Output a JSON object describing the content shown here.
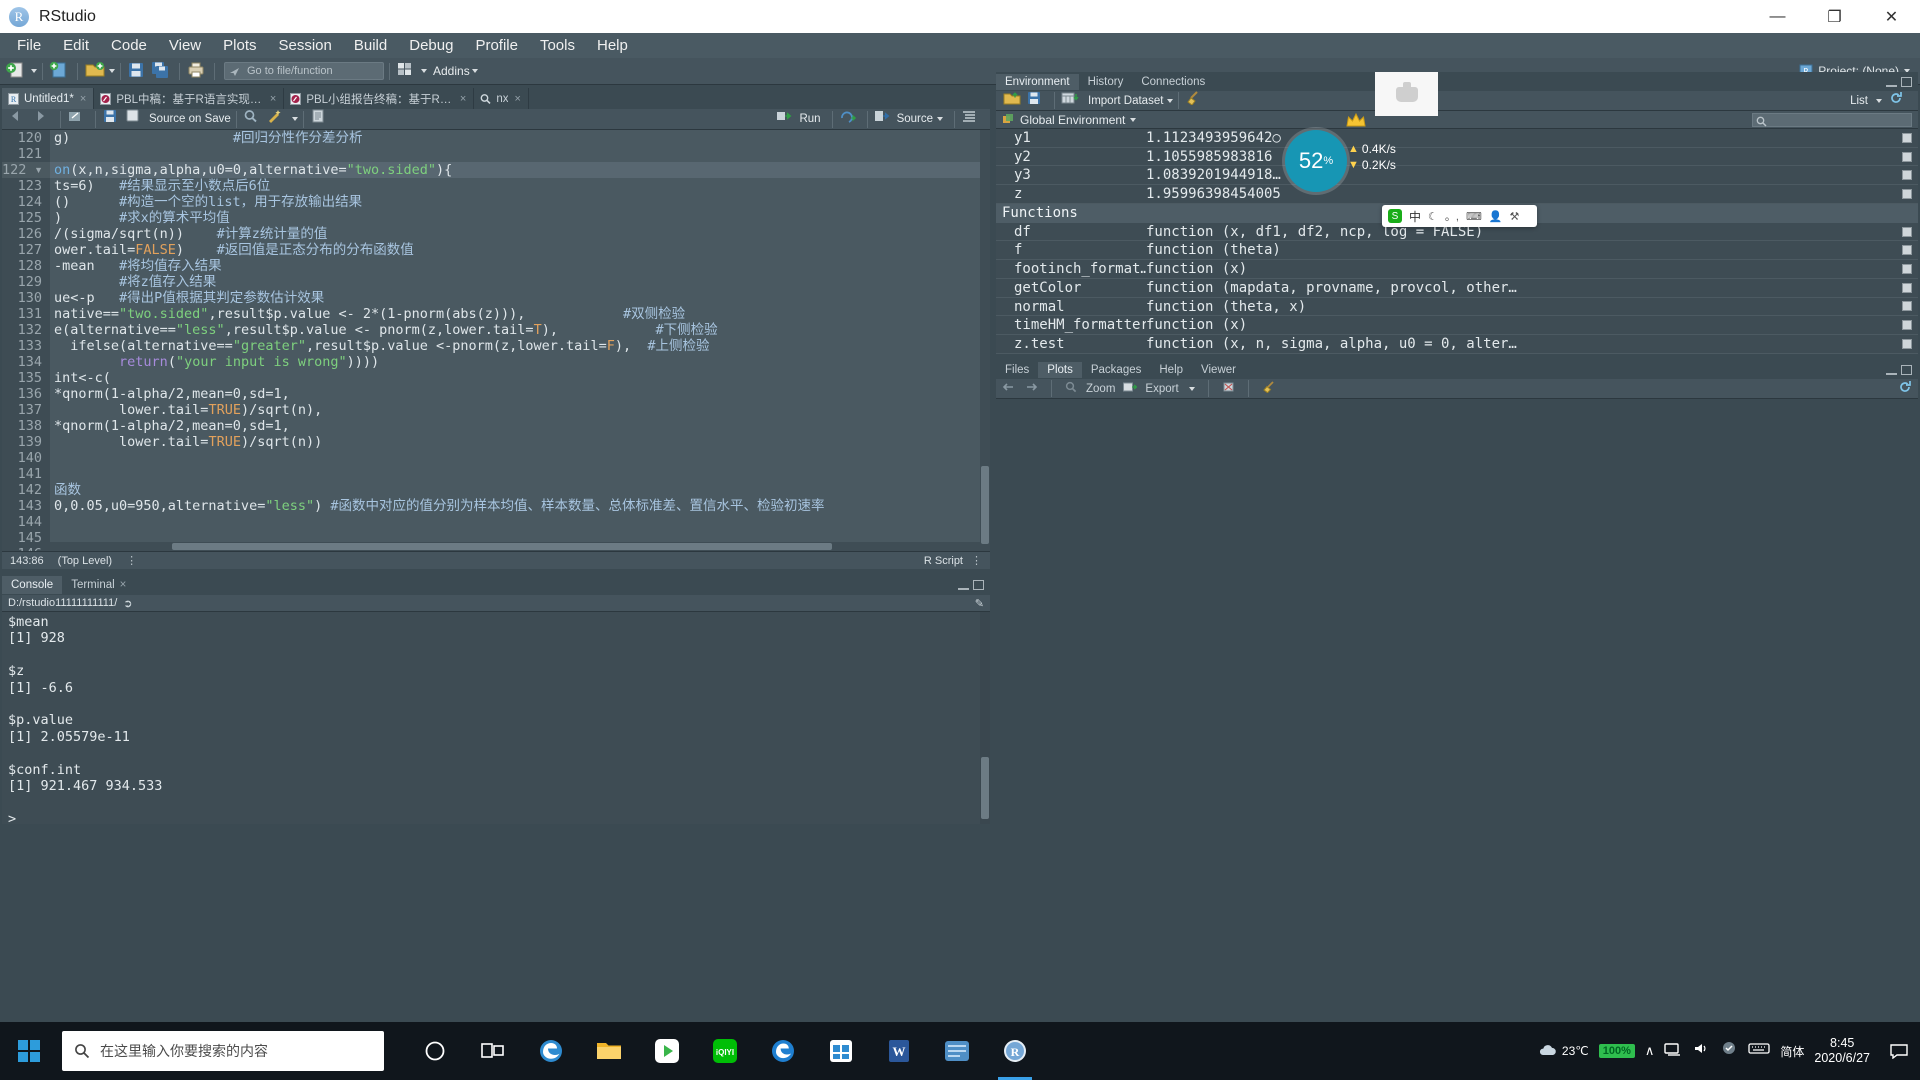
{
  "titlebar": {
    "app_name": "RStudio",
    "logo_letter": "R",
    "minimize": "—",
    "maximize": "❐",
    "close": "✕"
  },
  "menubar": {
    "items": [
      "File",
      "Edit",
      "Code",
      "View",
      "Plots",
      "Session",
      "Build",
      "Debug",
      "Profile",
      "Tools",
      "Help"
    ]
  },
  "main_toolbar": {
    "goto_placeholder": "Go to file/function",
    "addins_label": "Addins",
    "project_label": "Project: (None)"
  },
  "source": {
    "tabs": [
      {
        "label": "Untitled1*",
        "icon": "r-script-icon",
        "active": true
      },
      {
        "label": "PBL中稿：基于R语言实现重庆房价走势...",
        "icon": "rmd-icon",
        "active": false
      },
      {
        "label": "PBL小组报告终稿：基于R语言实现重庆...",
        "icon": "rmd-icon",
        "active": false
      },
      {
        "label": "nx",
        "icon": "search-icon",
        "active": false
      }
    ],
    "toolbar": {
      "source_on_save": "Source on Save",
      "run_label": "Run",
      "source_label": "Source"
    },
    "status": {
      "position": "143:86",
      "scope": "(Top Level)",
      "filetype": "R Script"
    },
    "lines": [
      {
        "n": "120",
        "fold": false,
        "hl": false,
        "tokens": [
          {
            "t": "g)",
            "c": "plain"
          },
          {
            "t": "                    ",
            "c": "plain"
          },
          {
            "t": "#回归分性作分差分析",
            "c": "com"
          }
        ]
      },
      {
        "n": "121",
        "fold": false,
        "hl": false,
        "tokens": []
      },
      {
        "n": "122",
        "fold": true,
        "hl": true,
        "tokens": [
          {
            "t": "on",
            "c": "fn"
          },
          {
            "t": "(x,n,sigma,alpha,u0=0,alternative=",
            "c": "plain"
          },
          {
            "t": "\"two.sided\"",
            "c": "str"
          },
          {
            "t": "){",
            "c": "plain"
          }
        ]
      },
      {
        "n": "123",
        "fold": false,
        "hl": false,
        "tokens": [
          {
            "t": "ts=6)",
            "c": "plain"
          },
          {
            "t": "   ",
            "c": "plain"
          },
          {
            "t": "#结果显示至小数点后6位",
            "c": "com"
          }
        ]
      },
      {
        "n": "124",
        "fold": false,
        "hl": false,
        "tokens": [
          {
            "t": "()",
            "c": "plain"
          },
          {
            "t": "      ",
            "c": "plain"
          },
          {
            "t": "#构造一个空的list，用于存放输出结果",
            "c": "com"
          }
        ]
      },
      {
        "n": "125",
        "fold": false,
        "hl": false,
        "tokens": [
          {
            "t": ")",
            "c": "plain"
          },
          {
            "t": "       ",
            "c": "plain"
          },
          {
            "t": "#求x的算术平均值",
            "c": "com"
          }
        ]
      },
      {
        "n": "126",
        "fold": false,
        "hl": false,
        "tokens": [
          {
            "t": "/(sigma/sqrt(n))",
            "c": "plain"
          },
          {
            "t": "    ",
            "c": "plain"
          },
          {
            "t": "#计算z统计量的值",
            "c": "com"
          }
        ]
      },
      {
        "n": "127",
        "fold": false,
        "hl": false,
        "tokens": [
          {
            "t": "ower.tail=",
            "c": "plain"
          },
          {
            "t": "FALSE",
            "c": "kw"
          },
          {
            "t": ")",
            "c": "plain"
          },
          {
            "t": "    ",
            "c": "plain"
          },
          {
            "t": "#返回值是正态分布的分布函数值",
            "c": "com"
          }
        ]
      },
      {
        "n": "128",
        "fold": false,
        "hl": false,
        "tokens": [
          {
            "t": "-mean",
            "c": "plain"
          },
          {
            "t": "   ",
            "c": "plain"
          },
          {
            "t": "#将均值存入结果",
            "c": "com"
          }
        ]
      },
      {
        "n": "129",
        "fold": false,
        "hl": false,
        "tokens": [
          {
            "t": "        ",
            "c": "plain"
          },
          {
            "t": "#将z值存入结果",
            "c": "com"
          }
        ]
      },
      {
        "n": "130",
        "fold": false,
        "hl": false,
        "tokens": [
          {
            "t": "ue<-p",
            "c": "plain"
          },
          {
            "t": "   ",
            "c": "plain"
          },
          {
            "t": "#得出P值根据其判定参数估计效果",
            "c": "com"
          }
        ]
      },
      {
        "n": "131",
        "fold": false,
        "hl": false,
        "tokens": [
          {
            "t": "native==",
            "c": "plain"
          },
          {
            "t": "\"two.sided\"",
            "c": "str"
          },
          {
            "t": ",result$p.value <- 2*(1-pnorm(abs(z))),",
            "c": "plain"
          },
          {
            "t": "            ",
            "c": "plain"
          },
          {
            "t": "#双侧检验",
            "c": "com"
          }
        ]
      },
      {
        "n": "132",
        "fold": false,
        "hl": false,
        "tokens": [
          {
            "t": "e(alternative==",
            "c": "plain"
          },
          {
            "t": "\"less\"",
            "c": "str"
          },
          {
            "t": ",result$p.value <- pnorm(z,lower.tail=",
            "c": "plain"
          },
          {
            "t": "T",
            "c": "kw"
          },
          {
            "t": "),",
            "c": "plain"
          },
          {
            "t": "            ",
            "c": "plain"
          },
          {
            "t": "#下侧检验",
            "c": "com"
          }
        ]
      },
      {
        "n": "133",
        "fold": false,
        "hl": false,
        "tokens": [
          {
            "t": "  ifelse(alternative==",
            "c": "plain"
          },
          {
            "t": "\"greater\"",
            "c": "str"
          },
          {
            "t": ",result$p.value <-pnorm(z,lower.tail=",
            "c": "plain"
          },
          {
            "t": "F",
            "c": "kw"
          },
          {
            "t": "),",
            "c": "plain"
          },
          {
            "t": "  ",
            "c": "plain"
          },
          {
            "t": "#上侧检验",
            "c": "com"
          }
        ]
      },
      {
        "n": "134",
        "fold": false,
        "hl": false,
        "tokens": [
          {
            "t": "        ",
            "c": "plain"
          },
          {
            "t": "return",
            "c": "pur"
          },
          {
            "t": "(",
            "c": "plain"
          },
          {
            "t": "\"your input is wrong\"",
            "c": "str"
          },
          {
            "t": "))))",
            "c": "plain"
          }
        ]
      },
      {
        "n": "135",
        "fold": false,
        "hl": false,
        "tokens": [
          {
            "t": "int<-c(",
            "c": "plain"
          }
        ]
      },
      {
        "n": "136",
        "fold": false,
        "hl": false,
        "tokens": [
          {
            "t": "*qnorm(1-alpha/2,mean=0,sd=1,",
            "c": "plain"
          }
        ]
      },
      {
        "n": "137",
        "fold": false,
        "hl": false,
        "tokens": [
          {
            "t": "        lower.tail=",
            "c": "plain"
          },
          {
            "t": "TRUE",
            "c": "kw"
          },
          {
            "t": ")/sqrt(n),",
            "c": "plain"
          }
        ]
      },
      {
        "n": "138",
        "fold": false,
        "hl": false,
        "tokens": [
          {
            "t": "*qnorm(1-alpha/2,mean=0,sd=1,",
            "c": "plain"
          }
        ]
      },
      {
        "n": "139",
        "fold": false,
        "hl": false,
        "tokens": [
          {
            "t": "        lower.tail=",
            "c": "plain"
          },
          {
            "t": "TRUE",
            "c": "kw"
          },
          {
            "t": ")/sqrt(n))",
            "c": "plain"
          }
        ]
      },
      {
        "n": "140",
        "fold": false,
        "hl": false,
        "tokens": []
      },
      {
        "n": "141",
        "fold": false,
        "hl": false,
        "tokens": []
      },
      {
        "n": "142",
        "fold": false,
        "hl": false,
        "tokens": [
          {
            "t": "函数",
            "c": "com"
          }
        ]
      },
      {
        "n": "143",
        "fold": false,
        "hl": false,
        "tokens": [
          {
            "t": "0,0.05,u0=950,alternative=",
            "c": "plain"
          },
          {
            "t": "\"less\"",
            "c": "str"
          },
          {
            "t": ") ",
            "c": "plain"
          },
          {
            "t": "#函数中对应的值分别为样本均值、样本数量、总体标准差、置信水平、检验初速率",
            "c": "com"
          }
        ]
      },
      {
        "n": "144",
        "fold": false,
        "hl": false,
        "tokens": []
      },
      {
        "n": "145",
        "fold": false,
        "hl": false,
        "tokens": []
      },
      {
        "n": "146",
        "fold": false,
        "hl": false,
        "tokens": []
      }
    ]
  },
  "console": {
    "tabs": [
      {
        "label": "Console",
        "active": true
      },
      {
        "label": "Terminal",
        "active": false
      }
    ],
    "path": "D:/rstudio11111111111/",
    "output": [
      "$mean",
      "[1] 928",
      "",
      "$z",
      "[1] -6.6",
      "",
      "$p.value",
      "[1] 2.05579e-11",
      "",
      "$conf.int",
      "[1] 921.467 934.533",
      "",
      "> "
    ]
  },
  "environment": {
    "tabs": [
      {
        "label": "Environment",
        "active": true
      },
      {
        "label": "History",
        "active": false
      },
      {
        "label": "Connections",
        "active": false
      }
    ],
    "toolbar": {
      "import_dataset": "Import Dataset",
      "list_label": "List"
    },
    "scope": "Global Environment",
    "values": [
      {
        "name": "y1",
        "value": "1.1123493959642○"
      },
      {
        "name": "y2",
        "value": "1.1055985983816"
      },
      {
        "name": "y3",
        "value": "1.0839201944918…"
      },
      {
        "name": "z",
        "value": "1.95996398454005"
      }
    ],
    "functions_header": "Functions",
    "functions": [
      {
        "name": "df",
        "value": "function (x, df1, df2, ncp, log = FALSE)"
      },
      {
        "name": "f",
        "value": "function (theta)"
      },
      {
        "name": "footinch_format…",
        "value": "function (x)"
      },
      {
        "name": "getColor",
        "value": "function (mapdata, provname, provcol, other…"
      },
      {
        "name": "normal",
        "value": "function (theta, x)"
      },
      {
        "name": "timeHM_formatter",
        "value": "function (x)"
      },
      {
        "name": "z.test",
        "value": "function (x, n, sigma, alpha, u0 = 0, alter…"
      }
    ]
  },
  "plots_pane": {
    "tabs": [
      {
        "label": "Files",
        "active": false
      },
      {
        "label": "Plots",
        "active": true
      },
      {
        "label": "Packages",
        "active": false
      },
      {
        "label": "Help",
        "active": false
      },
      {
        "label": "Viewer",
        "active": false
      }
    ],
    "toolbar": {
      "zoom_label": "Zoom",
      "export_label": "Export"
    }
  },
  "overlays": {
    "speed_percent": "52",
    "percent_sign": "%",
    "upload_speed": "0.4K/s",
    "download_speed": "0.2K/s",
    "ime": {
      "mode": "中",
      "glyph_moon": "☾",
      "punct": "。,",
      "keyboard": "⌨",
      "tools": "⚒"
    }
  },
  "taskbar": {
    "search_placeholder": "在这里输入你要搜索的内容",
    "apps": [
      {
        "name": "cortana-icon",
        "glyph": "○"
      },
      {
        "name": "task-view-icon",
        "glyph": "⧉"
      },
      {
        "name": "edge-icon",
        "glyph": "e"
      },
      {
        "name": "file-explorer-icon",
        "glyph": "🗀"
      },
      {
        "name": "player-icon",
        "glyph": "▶"
      },
      {
        "name": "iqiyi-icon",
        "glyph": "iQIYI"
      },
      {
        "name": "browser-icon",
        "glyph": "e"
      },
      {
        "name": "store-icon",
        "glyph": "⊞"
      },
      {
        "name": "word-icon",
        "glyph": "W"
      },
      {
        "name": "rstudio-blue-icon",
        "glyph": "⌿"
      },
      {
        "name": "rstudio-icon",
        "glyph": "R"
      }
    ],
    "tray": {
      "weather": "23℃",
      "battery": "100%",
      "chevron": "∧",
      "ime_label": "简体",
      "time": "8:45",
      "date": "2020/6/27"
    }
  }
}
